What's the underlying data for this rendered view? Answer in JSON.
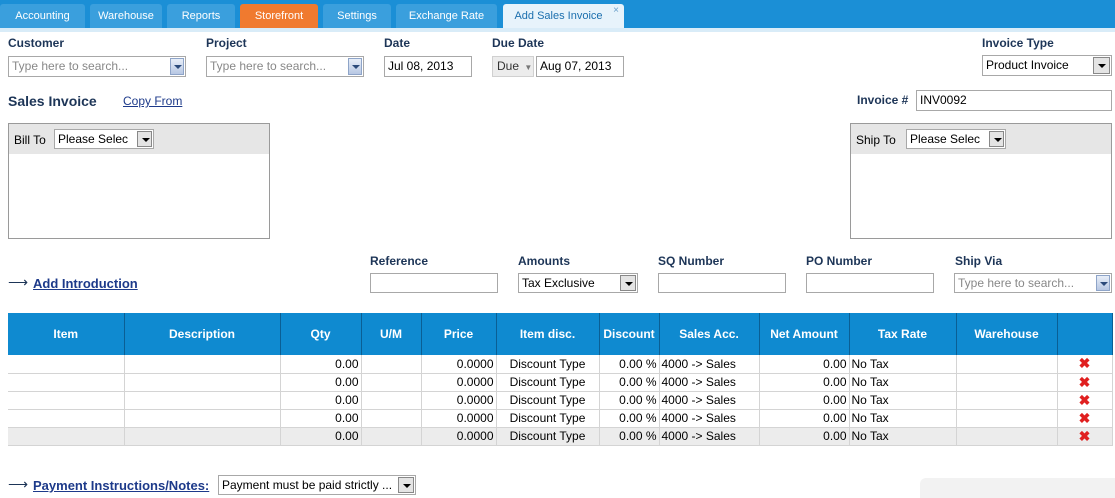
{
  "tabs": [
    {
      "label": "Accounting"
    },
    {
      "label": "Warehouse"
    },
    {
      "label": "Reports"
    },
    {
      "label": "Storefront"
    },
    {
      "label": "Settings"
    },
    {
      "label": "Exchange Rate"
    },
    {
      "label": "Add Sales Invoice",
      "close": "×"
    }
  ],
  "header": {
    "customer_label": "Customer",
    "customer_placeholder": "Type here to search...",
    "project_label": "Project",
    "project_placeholder": "Type here to search...",
    "date_label": "Date",
    "date_value": "Jul 08, 2013",
    "due_date_label": "Due Date",
    "due_selector": "Due",
    "due_date_value": "Aug 07, 2013",
    "invoice_type_label": "Invoice Type",
    "invoice_type_value": "Product Invoice"
  },
  "invoice": {
    "title": "Sales Invoice",
    "copy_from": "Copy From",
    "number_label": "Invoice #",
    "number_value": "INV0092",
    "bill_to_label": "Bill To",
    "bill_to_value": "Please Selec",
    "ship_to_label": "Ship To",
    "ship_to_value": "Please Selec"
  },
  "details": {
    "add_intro": "Add Introduction",
    "reference_label": "Reference",
    "reference_value": "",
    "amounts_label": "Amounts",
    "amounts_value": "Tax Exclusive",
    "sq_label": "SQ Number",
    "sq_value": "",
    "po_label": "PO Number",
    "po_value": "",
    "ship_via_label": "Ship Via",
    "ship_via_placeholder": "Type here to search..."
  },
  "grid": {
    "columns": [
      "Item",
      "Description",
      "Qty",
      "U/M",
      "Price",
      "Item disc.",
      "Discount",
      "Sales Acc.",
      "Net Amount",
      "Tax Rate",
      "Warehouse",
      ""
    ],
    "rows": [
      {
        "item": "",
        "description": "",
        "qty": "0.00",
        "um": "",
        "price": "0.0000",
        "item_disc": "Discount Type",
        "discount": "0.00 %",
        "sales_acc": "4000 -> Sales",
        "net": "0.00",
        "tax": "No Tax",
        "warehouse": ""
      },
      {
        "item": "",
        "description": "",
        "qty": "0.00",
        "um": "",
        "price": "0.0000",
        "item_disc": "Discount Type",
        "discount": "0.00 %",
        "sales_acc": "4000 -> Sales",
        "net": "0.00",
        "tax": "No Tax",
        "warehouse": ""
      },
      {
        "item": "",
        "description": "",
        "qty": "0.00",
        "um": "",
        "price": "0.0000",
        "item_disc": "Discount Type",
        "discount": "0.00 %",
        "sales_acc": "4000 -> Sales",
        "net": "0.00",
        "tax": "No Tax",
        "warehouse": ""
      },
      {
        "item": "",
        "description": "",
        "qty": "0.00",
        "um": "",
        "price": "0.0000",
        "item_disc": "Discount Type",
        "discount": "0.00 %",
        "sales_acc": "4000 -> Sales",
        "net": "0.00",
        "tax": "No Tax",
        "warehouse": ""
      },
      {
        "item": "",
        "description": "",
        "qty": "0.00",
        "um": "",
        "price": "0.0000",
        "item_disc": "Discount Type",
        "discount": "0.00 %",
        "sales_acc": "4000 -> Sales",
        "net": "0.00",
        "tax": "No Tax",
        "warehouse": ""
      }
    ],
    "delete_icon": "✖"
  },
  "footer": {
    "payment_label": "Payment Instructions/Notes:",
    "payment_value": "Payment must be paid strictly ..."
  },
  "icons": {
    "arrow": "⟶"
  },
  "colors": {
    "tab_bar": "#1b8fd6",
    "tab_active_text": "#1b6fae",
    "storefront_tab": "#f07a2f",
    "grid_header": "#0f8ad0",
    "delete": "#e02020"
  }
}
